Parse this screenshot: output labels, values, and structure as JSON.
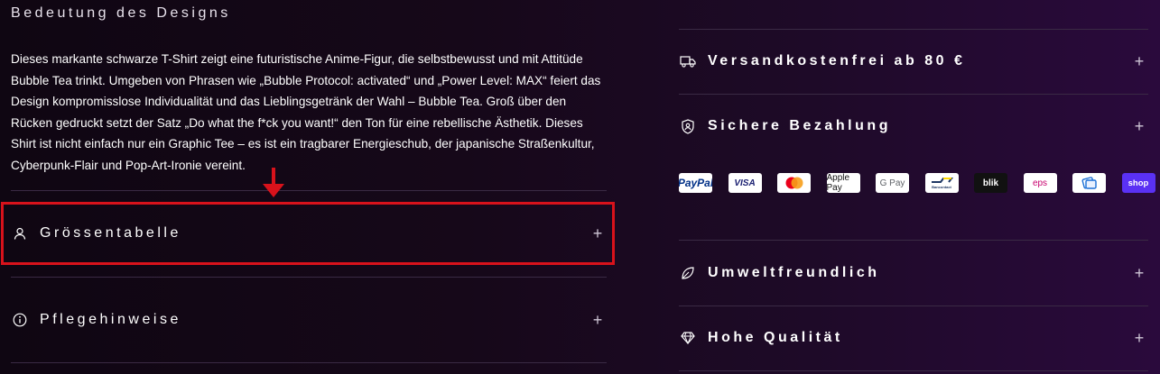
{
  "left": {
    "heading": "Bedeutung des Designs",
    "description": "Dieses markante schwarze T-Shirt zeigt eine futuristische Anime-Figur, die selbstbewusst und mit Attitüde Bubble Tea trinkt. Umgeben von Phrasen wie „Bubble Protocol: activated“ und „Power Level: MAX“ feiert das Design kompromisslose Individualität und das Lieblingsgetränk der Wahl – Bubble Tea. Groß über den Rücken gedruckt setzt der Satz „Do what the f*ck you want!“ den Ton für eine rebellische Ästhetik. Dieses Shirt ist nicht einfach nur ein Graphic Tee – es ist ein tragbarer Energieschub, der japanische Straßenkultur, Cyberpunk-Flair und Pop-Art-Ironie vereint.",
    "accordion": [
      {
        "label": "Grössentabelle",
        "icon": "person-icon",
        "toggle": "+"
      },
      {
        "label": "Pflegehinweise",
        "icon": "info-icon",
        "toggle": "+"
      }
    ]
  },
  "right": {
    "accordion": [
      {
        "label": "Versandkostenfrei ab 80 €",
        "icon": "truck-icon",
        "toggle": "+"
      },
      {
        "label": "Sichere Bezahlung",
        "icon": "shield-icon",
        "toggle": "+"
      },
      {
        "label": "Umweltfreundlich",
        "icon": "leaf-icon",
        "toggle": "+"
      },
      {
        "label": "Hohe Qualität",
        "icon": "diamond-icon",
        "toggle": "+"
      }
    ],
    "payment_methods": [
      "PayPal",
      "VISA",
      "Mastercard",
      "Apple Pay",
      "G Pay",
      "Bancontact",
      "blik",
      "eps",
      "Wallet",
      "shop"
    ]
  },
  "colors": {
    "highlight": "#d8121b",
    "shop_pay": "#5a31f4"
  }
}
